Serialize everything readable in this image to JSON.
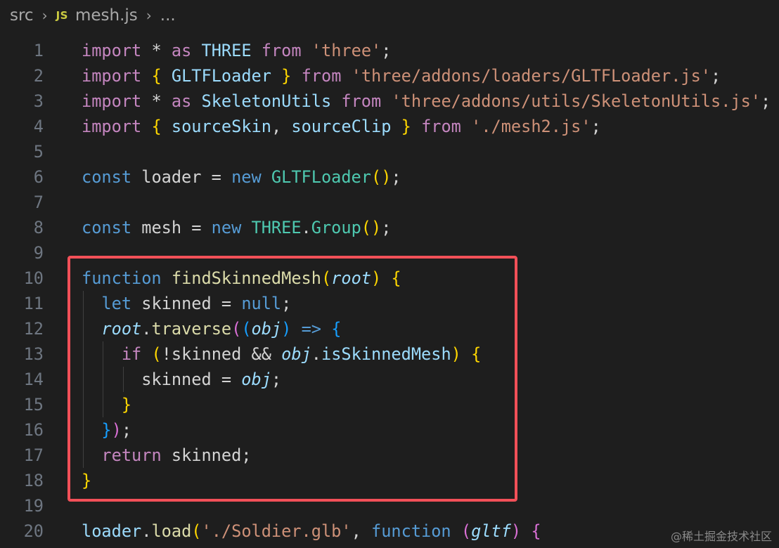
{
  "breadcrumb": {
    "folder": "src",
    "file_icon": "JS",
    "file": "mesh.js",
    "more": "..."
  },
  "lines": [
    {
      "n": "1",
      "tokens": [
        [
          "import",
          "kc"
        ],
        [
          " * ",
          "pu"
        ],
        [
          "as",
          "kc"
        ],
        [
          " ",
          "pu"
        ],
        [
          "THREE",
          "va"
        ],
        [
          " ",
          "pu"
        ],
        [
          "from",
          "kc"
        ],
        [
          " ",
          "pu"
        ],
        [
          "'three'",
          "st"
        ],
        [
          ";",
          "pu"
        ]
      ]
    },
    {
      "n": "2",
      "tokens": [
        [
          "import",
          "kc"
        ],
        [
          " ",
          "pu"
        ],
        [
          "{",
          "b1"
        ],
        [
          " ",
          "pu"
        ],
        [
          "GLTFLoader",
          "va"
        ],
        [
          " ",
          "pu"
        ],
        [
          "}",
          "b1"
        ],
        [
          " ",
          "pu"
        ],
        [
          "from",
          "kc"
        ],
        [
          " ",
          "pu"
        ],
        [
          "'three/addons/loaders/GLTFLoader.js'",
          "st"
        ],
        [
          ";",
          "pu"
        ]
      ]
    },
    {
      "n": "3",
      "tokens": [
        [
          "import",
          "kc"
        ],
        [
          " * ",
          "pu"
        ],
        [
          "as",
          "kc"
        ],
        [
          " ",
          "pu"
        ],
        [
          "SkeletonUtils",
          "va"
        ],
        [
          " ",
          "pu"
        ],
        [
          "from",
          "kc"
        ],
        [
          " ",
          "pu"
        ],
        [
          "'three/addons/utils/SkeletonUtils.js'",
          "st"
        ],
        [
          ";",
          "pu"
        ]
      ]
    },
    {
      "n": "4",
      "tokens": [
        [
          "import",
          "kc"
        ],
        [
          " ",
          "pu"
        ],
        [
          "{",
          "b1"
        ],
        [
          " ",
          "pu"
        ],
        [
          "sourceSkin",
          "va"
        ],
        [
          ", ",
          "pu"
        ],
        [
          "sourceClip",
          "va"
        ],
        [
          " ",
          "pu"
        ],
        [
          "}",
          "b1"
        ],
        [
          " ",
          "pu"
        ],
        [
          "from",
          "kc"
        ],
        [
          " ",
          "pu"
        ],
        [
          "'./mesh2.js'",
          "st"
        ],
        [
          ";",
          "pu"
        ]
      ]
    },
    {
      "n": "5",
      "tokens": []
    },
    {
      "n": "6",
      "tokens": [
        [
          "const",
          "kw"
        ],
        [
          " loader = ",
          "pu"
        ],
        [
          "new",
          "kw"
        ],
        [
          " ",
          "pu"
        ],
        [
          "GLTFLoader",
          "ty"
        ],
        [
          "(",
          "b1"
        ],
        [
          ")",
          "b1"
        ],
        [
          ";",
          "pu"
        ]
      ]
    },
    {
      "n": "7",
      "tokens": []
    },
    {
      "n": "8",
      "tokens": [
        [
          "const",
          "kw"
        ],
        [
          " mesh = ",
          "pu"
        ],
        [
          "new",
          "kw"
        ],
        [
          " ",
          "pu"
        ],
        [
          "THREE",
          "ty"
        ],
        [
          ".",
          "pu"
        ],
        [
          "Group",
          "ty"
        ],
        [
          "(",
          "b1"
        ],
        [
          ")",
          "b1"
        ],
        [
          ";",
          "pu"
        ]
      ]
    },
    {
      "n": "9",
      "tokens": []
    },
    {
      "n": "10",
      "tokens": [
        [
          "function",
          "kw"
        ],
        [
          " ",
          "pu"
        ],
        [
          "findSkinnedMesh",
          "fn"
        ],
        [
          "(",
          "b1"
        ],
        [
          "root",
          "va it"
        ],
        [
          ")",
          "b1"
        ],
        [
          " ",
          "pu"
        ],
        [
          "{",
          "b1"
        ]
      ]
    },
    {
      "n": "11",
      "tokens": [
        [
          "  ",
          "pu"
        ],
        [
          "let",
          "kw"
        ],
        [
          " skinned = ",
          "pu"
        ],
        [
          "null",
          "kw"
        ],
        [
          ";",
          "pu"
        ]
      ]
    },
    {
      "n": "12",
      "tokens": [
        [
          "  ",
          "pu"
        ],
        [
          "root",
          "va it"
        ],
        [
          ".",
          "pu"
        ],
        [
          "traverse",
          "fn"
        ],
        [
          "(",
          "b2"
        ],
        [
          "(",
          "b3"
        ],
        [
          "obj",
          "va it"
        ],
        [
          ")",
          "b3"
        ],
        [
          " => ",
          "kw"
        ],
        [
          "{",
          "b3"
        ]
      ]
    },
    {
      "n": "13",
      "tokens": [
        [
          "    ",
          "pu"
        ],
        [
          "if",
          "kc"
        ],
        [
          " ",
          "pu"
        ],
        [
          "(",
          "b1"
        ],
        [
          "!skinned && ",
          "pu"
        ],
        [
          "obj",
          "va it"
        ],
        [
          ".",
          "pu"
        ],
        [
          "isSkinnedMesh",
          "va"
        ],
        [
          ")",
          "b1"
        ],
        [
          " ",
          "pu"
        ],
        [
          "{",
          "b1"
        ]
      ]
    },
    {
      "n": "14",
      "tokens": [
        [
          "      skinned = ",
          "pu"
        ],
        [
          "obj",
          "va it"
        ],
        [
          ";",
          "pu"
        ]
      ]
    },
    {
      "n": "15",
      "tokens": [
        [
          "    ",
          "pu"
        ],
        [
          "}",
          "b1"
        ]
      ]
    },
    {
      "n": "16",
      "tokens": [
        [
          "  ",
          "pu"
        ],
        [
          "}",
          "b3"
        ],
        [
          ")",
          "b2"
        ],
        [
          ";",
          "pu"
        ]
      ]
    },
    {
      "n": "17",
      "tokens": [
        [
          "  ",
          "pu"
        ],
        [
          "return",
          "kc"
        ],
        [
          " skinned;",
          "pu"
        ]
      ]
    },
    {
      "n": "18",
      "tokens": [
        [
          "}",
          "b1"
        ]
      ]
    },
    {
      "n": "19",
      "tokens": []
    },
    {
      "n": "20",
      "tokens": [
        [
          "loader",
          "va"
        ],
        [
          ".",
          "pu"
        ],
        [
          "load",
          "fn"
        ],
        [
          "(",
          "b1"
        ],
        [
          "'./Soldier.glb'",
          "st"
        ],
        [
          ", ",
          "pu"
        ],
        [
          "function",
          "kw"
        ],
        [
          " ",
          "pu"
        ],
        [
          "(",
          "b2"
        ],
        [
          "gltf",
          "va it"
        ],
        [
          ")",
          "b2"
        ],
        [
          " ",
          "pu"
        ],
        [
          "{",
          "b2"
        ]
      ]
    }
  ],
  "colors": {
    "background": "#1e1e1e",
    "highlight_border": "#f25058",
    "line_number": "#6e7681"
  },
  "watermark": "@稀土掘金技术社区"
}
